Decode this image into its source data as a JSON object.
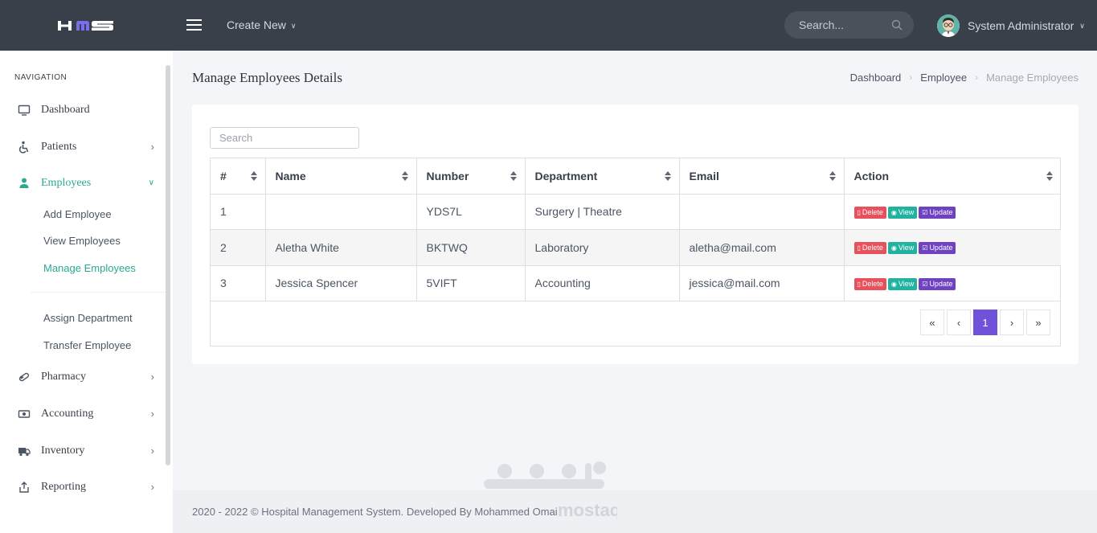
{
  "topbar": {
    "logo": "HMS",
    "create_new": "Create New",
    "search_placeholder": "Search...",
    "user_name": "System Administrator"
  },
  "sidebar": {
    "title": "NAVIGATION",
    "items": [
      {
        "label": "Dashboard",
        "icon": "monitor-icon"
      },
      {
        "label": "Patients",
        "icon": "wheelchair-icon"
      },
      {
        "label": "Employees",
        "icon": "user-icon"
      },
      {
        "label": "Pharmacy",
        "icon": "pill-icon"
      },
      {
        "label": "Accounting",
        "icon": "money-icon"
      },
      {
        "label": "Inventory",
        "icon": "truck-icon"
      },
      {
        "label": "Reporting",
        "icon": "export-icon"
      }
    ],
    "employees_sub": [
      "Add Employee",
      "View Employees",
      "Manage Employees",
      "Assign Department",
      "Transfer Employee"
    ]
  },
  "page": {
    "title": "Manage Employees Details",
    "breadcrumb": [
      "Dashboard",
      "Employee",
      "Manage Employees"
    ]
  },
  "table": {
    "search_placeholder": "Search",
    "columns": [
      "#",
      "Name",
      "Number",
      "Department",
      "Email",
      "Action"
    ],
    "rows": [
      {
        "no": "1",
        "name": "",
        "number": "YDS7L",
        "department": "Surgery | Theatre",
        "email": ""
      },
      {
        "no": "2",
        "name": "Aletha White",
        "number": "BKTWQ",
        "department": "Laboratory",
        "email": "aletha@mail.com"
      },
      {
        "no": "3",
        "name": "Jessica Spencer",
        "number": "5VIFT",
        "department": "Accounting",
        "email": "jessica@mail.com"
      }
    ],
    "actions": {
      "delete": "Delete",
      "view": "View",
      "update": "Update"
    },
    "pagination": [
      "«",
      "‹",
      "1",
      "›",
      "»"
    ]
  },
  "footer": "2020 - 2022 © Hospital Management System. Developed By Mohammed Omai",
  "watermark": "mostaql.com",
  "colors": {
    "topbar": "#3a4049",
    "accent": "#2ba893",
    "primary": "#6f52d9",
    "danger": "#e8505b",
    "info": "#22b3a0",
    "update": "#6f42c1"
  }
}
